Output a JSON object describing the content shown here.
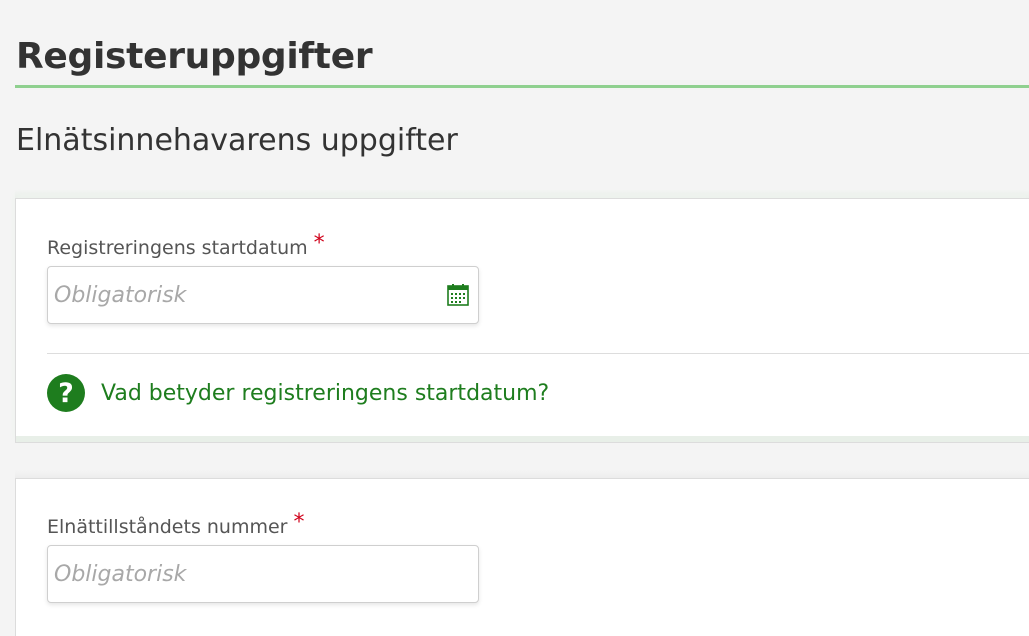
{
  "page": {
    "title": "Registeruppgifter",
    "section_title": "Elnätsinnehavarens uppgifter"
  },
  "start_date_field": {
    "label": "Registreringens startdatum",
    "required_marker": "*",
    "placeholder": "Obligatorisk",
    "value": "",
    "icon": "calendar-icon"
  },
  "help": {
    "icon": "question-circle-icon",
    "link_text": "Vad betyder registreringens startdatum?"
  },
  "license_number_field": {
    "label": "Elnättillståndets nummer",
    "required_marker": "*",
    "placeholder": "Obligatorisk",
    "value": ""
  },
  "colors": {
    "accent_green": "#1e7d1e",
    "title_rule": "#8fd08f",
    "required_red": "#d0021b"
  }
}
